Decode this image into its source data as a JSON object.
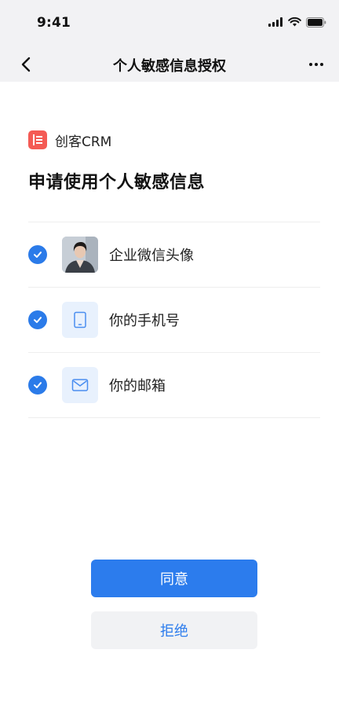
{
  "status_bar": {
    "time": "9:41"
  },
  "nav": {
    "title": "个人敏感信息授权"
  },
  "app": {
    "name": "创客CRM"
  },
  "headline": "申请使用个人敏感信息",
  "permissions": [
    {
      "label": "企业微信头像",
      "checked": true,
      "icon": "avatar-photo"
    },
    {
      "label": "你的手机号",
      "checked": true,
      "icon": "phone-icon"
    },
    {
      "label": "你的邮箱",
      "checked": true,
      "icon": "mail-icon"
    }
  ],
  "buttons": {
    "agree": "同意",
    "reject": "拒绝"
  },
  "colors": {
    "accent": "#2c7ced",
    "brand_logo": "#f45b55",
    "topbar_bg": "#f2f2f4"
  }
}
